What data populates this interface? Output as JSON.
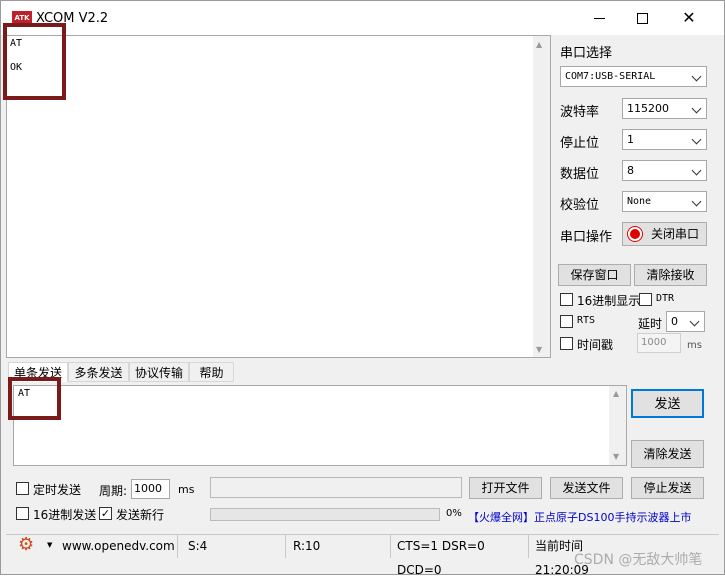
{
  "window": {
    "logo_text": "ATK",
    "title": "XCOM V2.2"
  },
  "receive_area": {
    "lines": [
      "AT",
      "OK"
    ]
  },
  "port": {
    "select_label": "串口选择",
    "port_value": "COM7:USB-SERIAL",
    "baud_label": "波特率",
    "baud_value": "115200",
    "stop_label": "停止位",
    "stop_value": "1",
    "data_label": "数据位",
    "data_value": "8",
    "parity_label": "校验位",
    "parity_value": "None",
    "op_label": "串口操作",
    "op_button": "关闭串口"
  },
  "recv_controls": {
    "save_window": "保存窗口",
    "clear_receive": "清除接收",
    "hex_display": "16进制显示",
    "dtr": "DTR",
    "rts": "RTS",
    "delay_label": "延时",
    "delay_value": "0",
    "timestamp": "时间戳",
    "timestamp_value": "1000",
    "ms": "ms"
  },
  "tabs": [
    "单条发送",
    "多条发送",
    "协议传输",
    "帮助"
  ],
  "send_area": {
    "text": "AT"
  },
  "send_buttons": {
    "send": "发送",
    "clear_send": "清除发送"
  },
  "bottom": {
    "timed_send": "定时发送",
    "period_label": "周期:",
    "period_value": "1000",
    "ms": "ms",
    "open_file": "打开文件",
    "send_file": "发送文件",
    "stop_send": "停止发送",
    "hex_send": "16进制发送",
    "send_newline": "发送新行",
    "progress": "0%",
    "progress_fraction": 0,
    "ad_text": "【火爆全网】正点原子DS100手持示波器上市"
  },
  "status": {
    "url": "www.openedv.com",
    "sent": "S:4",
    "received": "R:10",
    "lines": "CTS=1 DSR=0 DCD=0",
    "time": "当前时间 21:20:09",
    "watermark": "CSDN @无敌大帅笔"
  },
  "colors": {
    "accent_red": "#e00000",
    "highlight_box": "#7a1a1a",
    "ad_blue": "#0000cc",
    "gear": "#d04a1a"
  }
}
